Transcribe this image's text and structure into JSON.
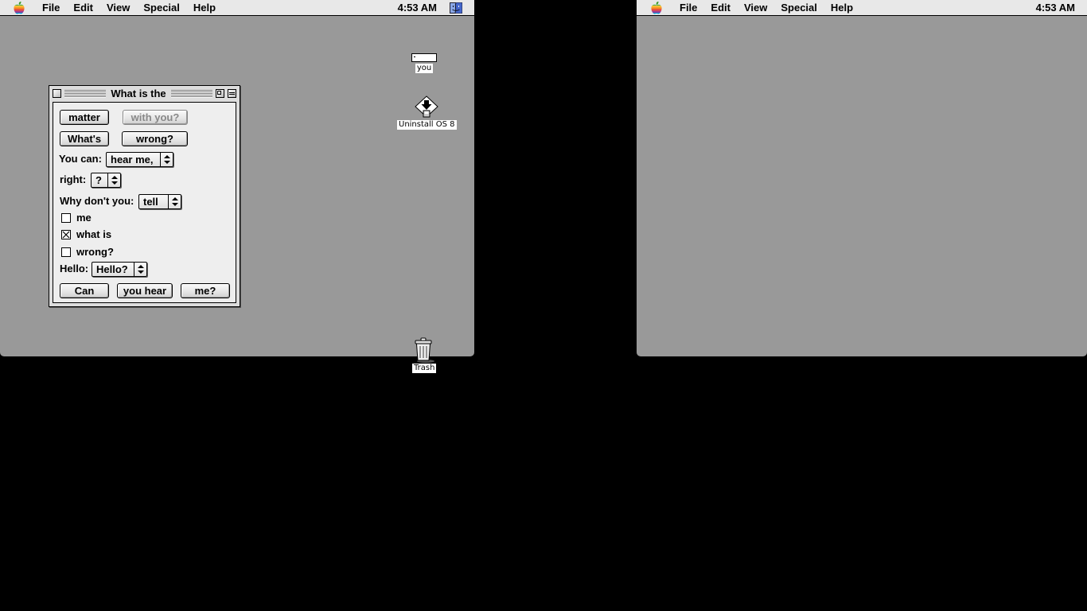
{
  "menubar": {
    "items": [
      "File",
      "Edit",
      "View",
      "Special",
      "Help"
    ],
    "clock": "4:53 AM"
  },
  "desktop_icons": {
    "volume": {
      "label": "you"
    },
    "installer": {
      "label": "Uninstall OS 8"
    },
    "trash": {
      "label": "Trash"
    }
  },
  "window": {
    "title": "What is the",
    "buttons": {
      "matter": "matter",
      "with_you": "with you?",
      "whats": "What's",
      "wrong": "wrong?",
      "can": "Can",
      "you_hear": "you hear",
      "me": "me?"
    },
    "labels": {
      "you_can": "You can:",
      "right": "right:",
      "why_dont_you": "Why don't you:",
      "hello": "Hello:"
    },
    "popups": {
      "you_can": "hear me,",
      "right": "?",
      "why_dont_you": "tell",
      "hello": "Hello?"
    },
    "checkboxes": [
      {
        "label": "me",
        "checked": false
      },
      {
        "label": "what is",
        "checked": true
      },
      {
        "label": "wrong?",
        "checked": false
      }
    ]
  },
  "colors": {
    "desktop": "#999999",
    "menubar": "#e8e8e8",
    "window_content": "#eeeeee"
  }
}
